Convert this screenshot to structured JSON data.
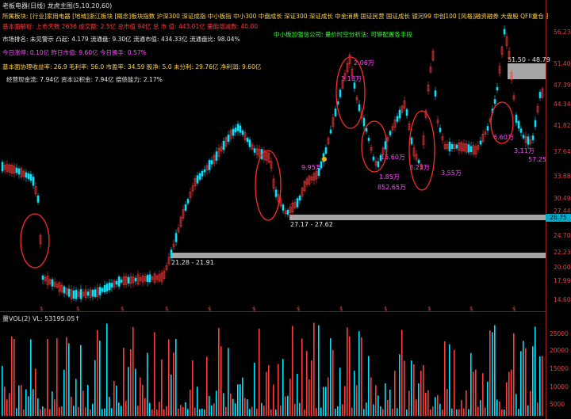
{
  "window": {
    "title": "老板电器(日线) 龙虎主图(5,10,20,60)"
  },
  "sectors": "所属板块: [行业]家用电器 [地域]浙江板块 [概念]板块指数 沪深300 深证成指 中小板指 中小300 中盘成长 深证300 深证成长 中金消费 国证民营 国证成长 银河99 中创100 [风格]融资融券 大盘股 QFII重仓 基金重仓 预减",
  "info": {
    "line1": "基本面解析: 上市天数 2636 成交额: 2.5亿 总市值 94亿 总 市 值: 443.01亿 量能增减数: 40.00",
    "line2a": "市场排名: 未见警示 凸起: 4.179 流通盘: 9.30亿 流通市值: 434.33亿 流通盘比: 98.04%",
    "line2b": "中小板加强信公司: 量价时空分析法: 可够配置各手段",
    "line3": "今日涨停: 0.10亿 昨日市值: 9.60亿 今日换手: 0.57%",
    "line4": "基本面协理收益率: 26.9 毛利率: 56.0 市盈率: 34.59 股净: 5.0 未分利: 29.76亿 净利润: 9.60亿",
    "line5": "经营现金流: 7.94亿 资本公积金: 7.94亿 偿债能力: 2.17%"
  },
  "y_axis": [
    "56.23",
    "51.40",
    "47.39",
    "44.34",
    "41.82",
    "37.64",
    "33.88",
    "30.49",
    "27.44",
    "24.70",
    "22.23",
    "20.00",
    "17.99",
    "14.60"
  ],
  "vol_axis": [
    "25000",
    "20000",
    "15000",
    "10000",
    "5000"
  ],
  "range_labels": {
    "r1": "51.50 - 48.79",
    "r2": "27.17 - 27.62",
    "r3": "21.28 - 21.91"
  },
  "price_tag": "26.75",
  "annotations": [
    "2.06万",
    "3.18万",
    "9.95万",
    "15.60万",
    "1.85万",
    "3.23万",
    "3.55万",
    "852.65万",
    "6.60万",
    "3.11万",
    "57.25"
  ],
  "volume": {
    "title": "量VOL(2) VL: 53195.05↑"
  },
  "colors": {
    "up": "#ff3b3b",
    "down": "#00e5ff",
    "yellow": "#ffd24a"
  }
}
